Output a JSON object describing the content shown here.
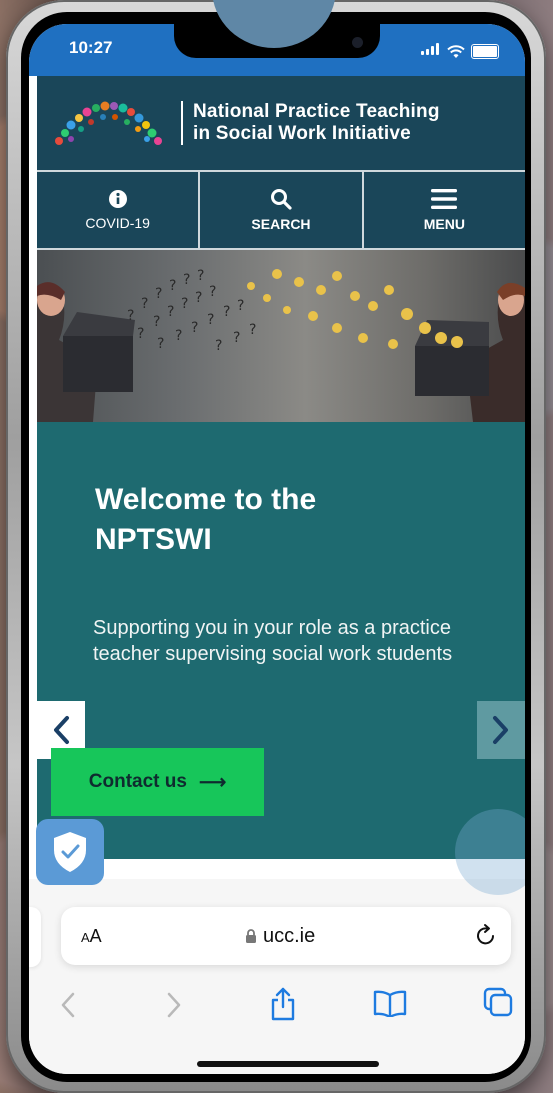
{
  "status_bar": {
    "time": "10:27"
  },
  "site": {
    "title_line1": "National Practice Teaching",
    "title_line2": "in Social Work Initiative",
    "nav": [
      {
        "label": "COVID-19",
        "icon": "info-icon"
      },
      {
        "label": "SEARCH",
        "icon": "search-icon"
      },
      {
        "label": "MENU",
        "icon": "hamburger-icon"
      }
    ]
  },
  "hero": {
    "heading_line1": "Welcome to the",
    "heading_line2": "NPTSWI",
    "tagline": "Supporting you in your role as a practice teacher supervising social work students",
    "cta_label": "Contact us",
    "cta_arrow": "⟶"
  },
  "browser": {
    "text_size_label_small": "A",
    "text_size_label_large": "A",
    "url": "ucc.ie"
  },
  "colors": {
    "status_bar": "#1f70c1",
    "header": "#1a4659",
    "hero": "#1e6a70",
    "cta": "#17c65a"
  }
}
